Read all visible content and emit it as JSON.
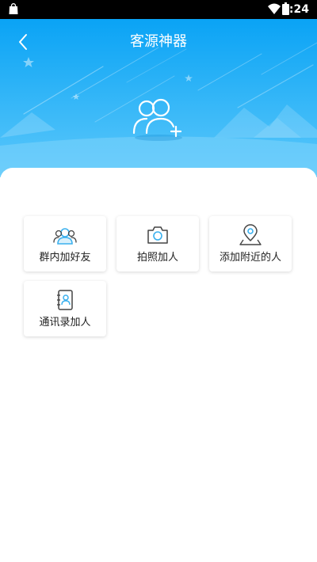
{
  "status_bar": {
    "time": "8:24",
    "icons": [
      "shopping-bag-icon",
      "wifi-icon",
      "battery-icon"
    ]
  },
  "header": {
    "title": "客源神器",
    "back_icon": "chevron-left-icon",
    "hero_icon": "add-user-icon"
  },
  "actions": [
    {
      "label": "群内加好友",
      "icon": "group-users-icon"
    },
    {
      "label": "拍照加人",
      "icon": "camera-icon"
    },
    {
      "label": "添加附近的人",
      "icon": "location-pin-icon"
    },
    {
      "label": "通讯录加人",
      "icon": "contacts-book-icon"
    }
  ],
  "colors": {
    "header_top": "#0aa3f5",
    "header_bottom": "#5cc8fb",
    "icon_blue": "#3ab0ee",
    "icon_dark": "#444444"
  }
}
